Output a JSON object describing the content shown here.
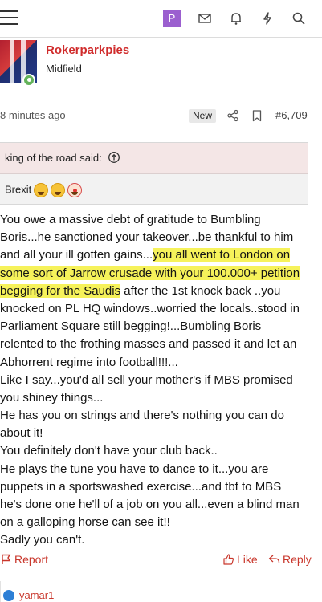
{
  "topbar": {
    "user_initial": "P",
    "icons": [
      "menu-icon",
      "envelope-icon",
      "bell-icon",
      "bolt-icon",
      "search-icon"
    ]
  },
  "post": {
    "username": "Rokerparkpies",
    "user_title": "Midfield",
    "time": "8 minutes ago",
    "badge": "New",
    "number": "#6,709",
    "quote": {
      "author": "king of the road said:",
      "text": "Brexit"
    },
    "lines": [
      [
        {
          "t": "You owe a massive debt of gratitude to Bumbling",
          "h": false
        }
      ],
      [
        {
          "t": "Boris...he sanctioned your takeover...be thankful to him",
          "h": false
        }
      ],
      [
        {
          "t": "and all your ill gotten gains...",
          "h": false
        },
        {
          "t": "you all went to London on",
          "h": true
        }
      ],
      [
        {
          "t": "some sort of Jarrow crusade with your 100.000+ petition",
          "h": true
        }
      ],
      [
        {
          "t": "begging for the Saudis",
          "h": true
        },
        {
          "t": " after the 1st knock back ..you",
          "h": false
        }
      ],
      [
        {
          "t": "knocked on PL HQ windows..worried the locals..stood in",
          "h": false
        }
      ],
      [
        {
          "t": "Parliament Square still begging!...Bumbling Boris",
          "h": false
        }
      ],
      [
        {
          "t": "relented to the frothing masses and passed it and let an",
          "h": false
        }
      ],
      [
        {
          "t": "Abhorrent regime into football!!!...",
          "h": false
        }
      ],
      [
        {
          "t": "Like I say...you'd all sell your mother's if MBS promised",
          "h": false
        }
      ],
      [
        {
          "t": "you shiney things...",
          "h": false
        }
      ],
      [
        {
          "t": "He has you on strings and there's nothing you can do",
          "h": false
        }
      ],
      [
        {
          "t": "about it!",
          "h": false
        }
      ],
      [
        {
          "t": "You definitely don't have your club back..",
          "h": false
        }
      ],
      [
        {
          "t": "He plays the tune you have to dance to it...you are",
          "h": false
        }
      ],
      [
        {
          "t": "puppets in a sportswashed exercise...and tbf to MBS",
          "h": false
        }
      ],
      [
        {
          "t": "he's done one he'll of a job on you all...even a blind man",
          "h": false
        }
      ],
      [
        {
          "t": "on a galloping horse can see it!!",
          "h": false
        }
      ],
      [
        {
          "t": "Sadly you can't.",
          "h": false
        }
      ]
    ],
    "actions": {
      "report": "Report",
      "like": "Like",
      "reply": "Reply"
    },
    "liked_by": "yamar1"
  },
  "colors": {
    "accent": "#c9372c",
    "username": "#d02c2c",
    "highlight": "#f6f25a",
    "quote_header": "#f4e6e6",
    "user_badge": "#9b5fcf"
  }
}
